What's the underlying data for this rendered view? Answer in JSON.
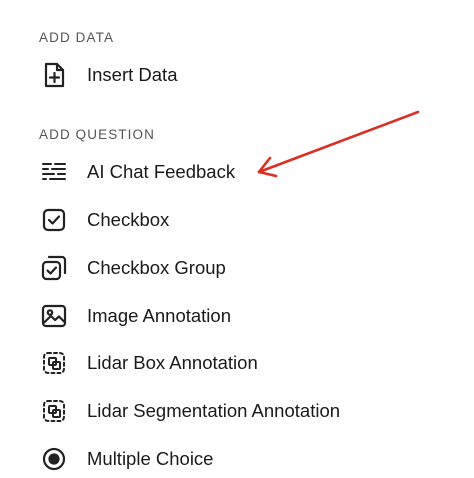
{
  "sections": {
    "add_data": {
      "title": "ADD DATA",
      "items": [
        {
          "label": "Insert Data",
          "icon": "insert-data-icon"
        }
      ]
    },
    "add_question": {
      "title": "ADD QUESTION",
      "items": [
        {
          "label": "AI Chat Feedback",
          "icon": "chat-feedback-icon"
        },
        {
          "label": "Checkbox",
          "icon": "checkbox-icon"
        },
        {
          "label": "Checkbox Group",
          "icon": "checkbox-group-icon"
        },
        {
          "label": "Image Annotation",
          "icon": "image-icon"
        },
        {
          "label": "Lidar Box Annotation",
          "icon": "lidar-box-icon"
        },
        {
          "label": "Lidar Segmentation Annotation",
          "icon": "lidar-segmentation-icon"
        },
        {
          "label": "Multiple Choice",
          "icon": "radio-icon"
        }
      ]
    }
  },
  "annotation": {
    "arrow_color": "#d93025"
  }
}
